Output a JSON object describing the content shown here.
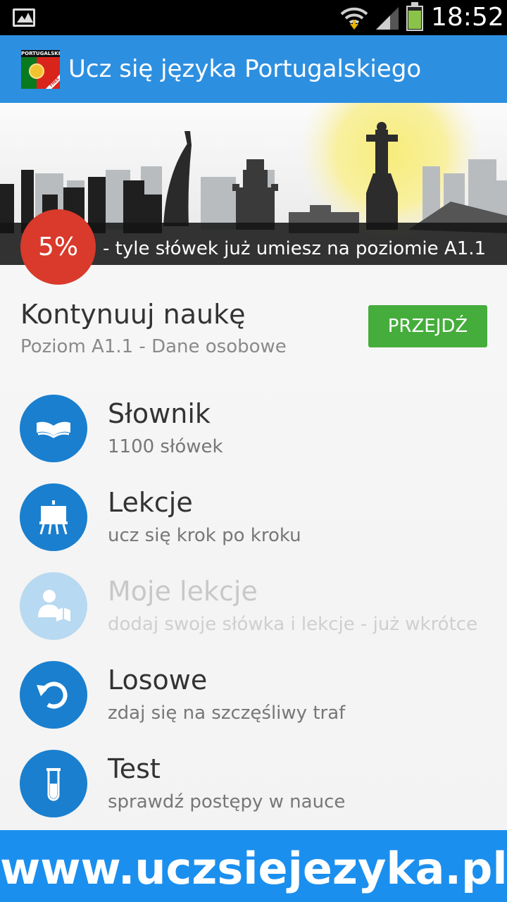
{
  "status_bar": {
    "time": "18:52",
    "icons": [
      "gallery-icon",
      "wifi-icon",
      "signal-icon",
      "battery-icon"
    ]
  },
  "app_bar": {
    "logo_text": "PORTUGALSKI",
    "logo_badge": "FREE",
    "title": "Ucz się języka Portugalskiego"
  },
  "banner": {
    "percent": "5%",
    "progress_text": "- tyle słówek już umiesz na poziomie A1.1"
  },
  "continue": {
    "title": "Kontynuuj naukę",
    "subtitle": "Poziom A1.1 - Dane osobowe",
    "button_label": "PRZEJDŹ"
  },
  "menu": [
    {
      "title": "Słownik",
      "subtitle": "1100 słówek",
      "icon": "book-icon",
      "enabled": true
    },
    {
      "title": "Lekcje",
      "subtitle": "ucz się krok po kroku",
      "icon": "easel-icon",
      "enabled": true
    },
    {
      "title": "Moje lekcje",
      "subtitle": "dodaj swoje słówka i lekcje - już wkrótce",
      "icon": "user-book-icon",
      "enabled": false
    },
    {
      "title": "Losowe",
      "subtitle": "zdaj się na szczęśliwy traf",
      "icon": "undo-icon",
      "enabled": true
    },
    {
      "title": "Test",
      "subtitle": "sprawdź postępy w nauce",
      "icon": "test-tube-icon",
      "enabled": true
    }
  ],
  "footer": {
    "url": "www.uczsiejezyka.pl"
  },
  "colors": {
    "app_bar": "#2d8fe0",
    "accent_circle": "#1a7fce",
    "go_button": "#45ad3c",
    "percent_badge": "#d93a2b",
    "footer": "#1b8fee"
  }
}
